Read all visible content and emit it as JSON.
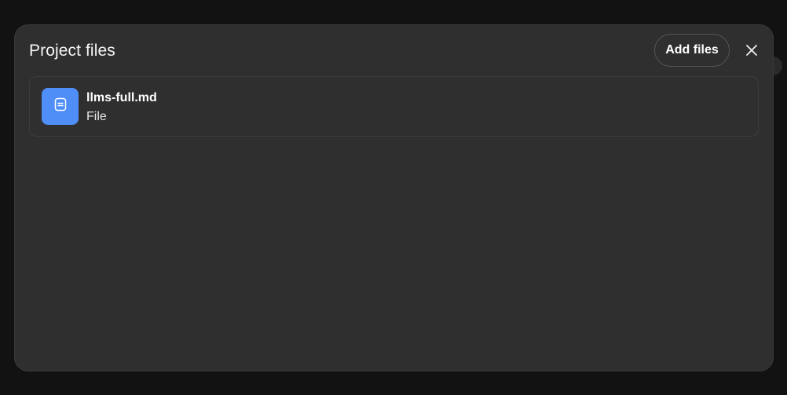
{
  "modal": {
    "title": "Project files",
    "add_files_label": "Add files",
    "close_icon": "close-icon"
  },
  "files": [
    {
      "name": "llms-full.md",
      "type": "File",
      "icon": "document-icon"
    }
  ],
  "colors": {
    "backdrop": "#121212",
    "modal_bg": "#2f2f2f",
    "file_icon_bg": "#4f8ef7",
    "text_primary": "#ffffff"
  }
}
